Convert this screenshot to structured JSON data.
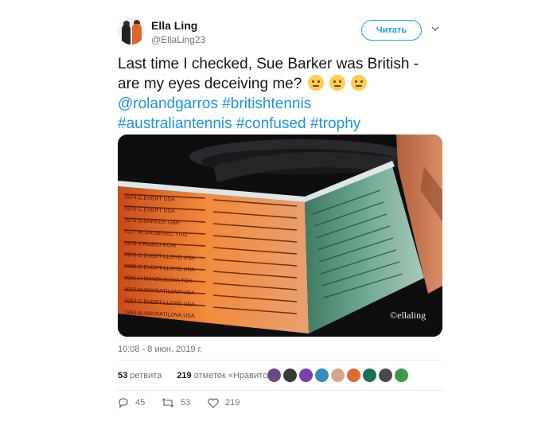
{
  "author": {
    "name": "Ella Ling",
    "handle": "@EllaLing23"
  },
  "follow_label": "Читать",
  "tweet": {
    "line1": "Last time I checked, Sue Barker was British -",
    "line2": "are my eyes deceiving me?",
    "hashtag_line1": "@rolandgarros #britishtennis",
    "hashtag_line2": "#australiantennis #confused #trophy"
  },
  "media": {
    "watermark": "©ellaling",
    "engravings_left": [
      "1974 C.EVERT USA",
      "1975 C.EVERT USA",
      "1976 S.BARKER GBR",
      "1977 M.JAUSEVEC YUG",
      "1978 V.RUZICI ROM",
      "1979 C.EVERT-LLOYD USA",
      "1980 C.EVERT-LLOYD USA",
      "1981 H.MANDLIKOVA TCH",
      "1982 M.NAVRATILOVA USA",
      "1983 C.EVERT-LLOYD USA",
      "1984 M.NAVRATILOVA USA"
    ]
  },
  "timestamp": "10:08 - 8 июн. 2019 г.",
  "stats": {
    "retweets_count": "53",
    "retweets_label": "ретвита",
    "likes_count": "219",
    "likes_label": "отметок «Нравится»"
  },
  "actions": {
    "replies": "45",
    "retweets": "53",
    "likes": "219"
  },
  "colors": {
    "link": "#1b95e0",
    "accent": "#1da1f2",
    "muted": "#657786"
  },
  "icons": [
    "reply-icon",
    "retweet-icon",
    "heart-icon",
    "chevron-down-icon"
  ]
}
